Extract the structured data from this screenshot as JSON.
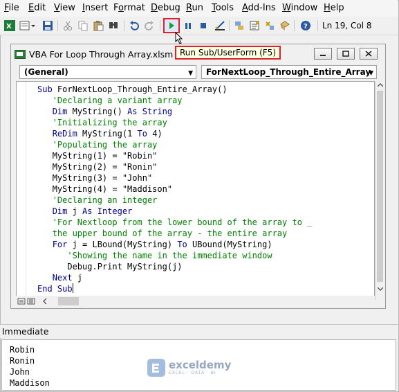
{
  "menu": [
    {
      "label": "File",
      "u": "F"
    },
    {
      "label": "Edit",
      "u": "E"
    },
    {
      "label": "View",
      "u": "V"
    },
    {
      "label": "Insert",
      "u": "I"
    },
    {
      "label": "Format",
      "u": "o"
    },
    {
      "label": "Debug",
      "u": "D"
    },
    {
      "label": "Run",
      "u": "R"
    },
    {
      "label": "Tools",
      "u": "T"
    },
    {
      "label": "Add-Ins",
      "u": "A"
    },
    {
      "label": "Window",
      "u": "W"
    },
    {
      "label": "Help",
      "u": "H"
    }
  ],
  "toolbar": {
    "icons": [
      "excel-view-icon",
      "insert-module-icon",
      "save-icon",
      "cut-icon",
      "copy-icon",
      "paste-icon",
      "find-icon",
      "undo-icon",
      "redo-icon",
      "run-icon",
      "break-icon",
      "reset-icon",
      "design-mode-icon",
      "project-explorer-icon",
      "properties-icon",
      "object-browser-icon",
      "toolbox-icon",
      "help-icon"
    ],
    "status": "Ln 19, Col 8",
    "tooltip": "Run Sub/UserForm (F5)",
    "accent_run": "#1a9b3c",
    "highlight_color": "#e0212d"
  },
  "code_window": {
    "title": "VBA For Loop Through Array.xlsm - Module1 (Code)",
    "object_combo": "(General)",
    "procedure_combo": "ForNextLoop_Through_Entire_Array",
    "lines": [
      {
        "indent": 0,
        "parts": [
          {
            "t": "Sub ",
            "c": "kw"
          },
          {
            "t": "ForNextLoop_Through_Entire_Array()",
            "c": ""
          }
        ]
      },
      {
        "indent": 1,
        "parts": [
          {
            "t": "'Declaring a variant array",
            "c": "cm"
          }
        ]
      },
      {
        "indent": 1,
        "parts": [
          {
            "t": "Dim ",
            "c": "kw"
          },
          {
            "t": "MyString() ",
            "c": ""
          },
          {
            "t": "As String",
            "c": "kw"
          }
        ]
      },
      {
        "indent": 1,
        "parts": [
          {
            "t": "'Initializing the array",
            "c": "cm"
          }
        ]
      },
      {
        "indent": 1,
        "parts": [
          {
            "t": "ReDim ",
            "c": "kw"
          },
          {
            "t": "MyString(1 ",
            "c": ""
          },
          {
            "t": "To ",
            "c": "kw"
          },
          {
            "t": "4)",
            "c": ""
          }
        ]
      },
      {
        "indent": 1,
        "parts": [
          {
            "t": "'Populating the array",
            "c": "cm"
          }
        ]
      },
      {
        "indent": 1,
        "parts": [
          {
            "t": "MyString(1) = \"Robin\"",
            "c": ""
          }
        ]
      },
      {
        "indent": 1,
        "parts": [
          {
            "t": "MyString(2) = \"Ronin\"",
            "c": ""
          }
        ]
      },
      {
        "indent": 1,
        "parts": [
          {
            "t": "MyString(3) = \"John\"",
            "c": ""
          }
        ]
      },
      {
        "indent": 1,
        "parts": [
          {
            "t": "MyString(4) = \"Maddison\"",
            "c": ""
          }
        ]
      },
      {
        "indent": 1,
        "parts": [
          {
            "t": "'Declaring an integer",
            "c": "cm"
          }
        ]
      },
      {
        "indent": 1,
        "parts": [
          {
            "t": "Dim ",
            "c": "kw"
          },
          {
            "t": "j ",
            "c": ""
          },
          {
            "t": "As Integer",
            "c": "kw"
          }
        ]
      },
      {
        "indent": 1,
        "parts": [
          {
            "t": "'For Nextloop from the lower bound of the array to _",
            "c": "cm"
          }
        ]
      },
      {
        "indent": 1,
        "parts": [
          {
            "t": "the upper bound of the array - the entire array",
            "c": "cm"
          }
        ]
      },
      {
        "indent": 1,
        "parts": [
          {
            "t": "For ",
            "c": "kw"
          },
          {
            "t": "j = LBound(MyString) ",
            "c": ""
          },
          {
            "t": "To ",
            "c": "kw"
          },
          {
            "t": "UBound(MyString)",
            "c": ""
          }
        ]
      },
      {
        "indent": 2,
        "parts": [
          {
            "t": "'Showing the name in the immediate window",
            "c": "cm"
          }
        ]
      },
      {
        "indent": 2,
        "parts": [
          {
            "t": "Debug.Print MyString(j)",
            "c": ""
          }
        ]
      },
      {
        "indent": 1,
        "parts": [
          {
            "t": "Next ",
            "c": "kw"
          },
          {
            "t": "j",
            "c": ""
          }
        ]
      },
      {
        "indent": 0,
        "parts": [
          {
            "t": "End Sub",
            "c": "kw"
          }
        ]
      }
    ]
  },
  "immediate": {
    "title": "Immediate",
    "lines": [
      "Robin",
      "Ronin",
      "John",
      "Maddison"
    ]
  },
  "watermark": {
    "name": "exceldemy",
    "tagline": "EXCEL · DATA · BI"
  },
  "colors": {
    "keyword": "#00008b",
    "comment": "#008000"
  }
}
